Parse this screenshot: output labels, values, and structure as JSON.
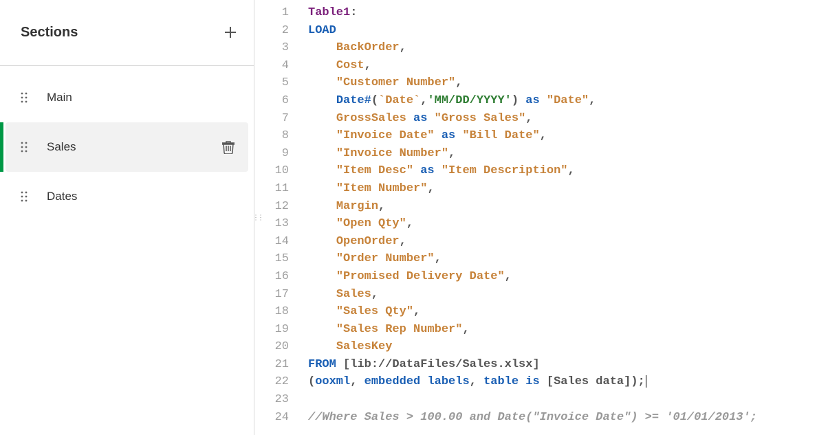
{
  "sidebar": {
    "title": "Sections",
    "items": [
      {
        "label": "Main",
        "active": false
      },
      {
        "label": "Sales",
        "active": true
      },
      {
        "label": "Dates",
        "active": false
      }
    ]
  },
  "editor": {
    "lines": [
      [
        {
          "c": "tk-tbl",
          "t": "Table1"
        },
        {
          "c": "tk-punct",
          "t": ":"
        }
      ],
      [
        {
          "c": "tk-key",
          "t": "LOAD"
        }
      ],
      [
        {
          "c": "tk-plain",
          "t": "    "
        },
        {
          "c": "tk-field",
          "t": "BackOrder"
        },
        {
          "c": "tk-punct",
          "t": ","
        }
      ],
      [
        {
          "c": "tk-plain",
          "t": "    "
        },
        {
          "c": "tk-field",
          "t": "Cost"
        },
        {
          "c": "tk-punct",
          "t": ","
        }
      ],
      [
        {
          "c": "tk-plain",
          "t": "    "
        },
        {
          "c": "tk-str",
          "t": "\"Customer Number\""
        },
        {
          "c": "tk-punct",
          "t": ","
        }
      ],
      [
        {
          "c": "tk-plain",
          "t": "    "
        },
        {
          "c": "tk-fn",
          "t": "Date#"
        },
        {
          "c": "tk-punct",
          "t": "("
        },
        {
          "c": "tk-btick",
          "t": "`Date`"
        },
        {
          "c": "tk-punct",
          "t": ","
        },
        {
          "c": "tk-lit",
          "t": "'MM/DD/YYYY'"
        },
        {
          "c": "tk-punct",
          "t": ")"
        },
        {
          "c": "tk-plain",
          "t": " "
        },
        {
          "c": "tk-as",
          "t": "as"
        },
        {
          "c": "tk-plain",
          "t": " "
        },
        {
          "c": "tk-str",
          "t": "\"Date\""
        },
        {
          "c": "tk-punct",
          "t": ","
        }
      ],
      [
        {
          "c": "tk-plain",
          "t": "    "
        },
        {
          "c": "tk-field",
          "t": "GrossSales"
        },
        {
          "c": "tk-plain",
          "t": " "
        },
        {
          "c": "tk-as",
          "t": "as"
        },
        {
          "c": "tk-plain",
          "t": " "
        },
        {
          "c": "tk-str",
          "t": "\"Gross Sales\""
        },
        {
          "c": "tk-punct",
          "t": ","
        }
      ],
      [
        {
          "c": "tk-plain",
          "t": "    "
        },
        {
          "c": "tk-str",
          "t": "\"Invoice Date\""
        },
        {
          "c": "tk-plain",
          "t": " "
        },
        {
          "c": "tk-as",
          "t": "as"
        },
        {
          "c": "tk-plain",
          "t": " "
        },
        {
          "c": "tk-str",
          "t": "\"Bill Date\""
        },
        {
          "c": "tk-punct",
          "t": ","
        }
      ],
      [
        {
          "c": "tk-plain",
          "t": "    "
        },
        {
          "c": "tk-str",
          "t": "\"Invoice Number\""
        },
        {
          "c": "tk-punct",
          "t": ","
        }
      ],
      [
        {
          "c": "tk-plain",
          "t": "    "
        },
        {
          "c": "tk-str",
          "t": "\"Item Desc\""
        },
        {
          "c": "tk-plain",
          "t": " "
        },
        {
          "c": "tk-as",
          "t": "as"
        },
        {
          "c": "tk-plain",
          "t": " "
        },
        {
          "c": "tk-str",
          "t": "\"Item Description\""
        },
        {
          "c": "tk-punct",
          "t": ","
        }
      ],
      [
        {
          "c": "tk-plain",
          "t": "    "
        },
        {
          "c": "tk-str",
          "t": "\"Item Number\""
        },
        {
          "c": "tk-punct",
          "t": ","
        }
      ],
      [
        {
          "c": "tk-plain",
          "t": "    "
        },
        {
          "c": "tk-field",
          "t": "Margin"
        },
        {
          "c": "tk-punct",
          "t": ","
        }
      ],
      [
        {
          "c": "tk-plain",
          "t": "    "
        },
        {
          "c": "tk-str",
          "t": "\"Open Qty\""
        },
        {
          "c": "tk-punct",
          "t": ","
        }
      ],
      [
        {
          "c": "tk-plain",
          "t": "    "
        },
        {
          "c": "tk-field",
          "t": "OpenOrder"
        },
        {
          "c": "tk-punct",
          "t": ","
        }
      ],
      [
        {
          "c": "tk-plain",
          "t": "    "
        },
        {
          "c": "tk-str",
          "t": "\"Order Number\""
        },
        {
          "c": "tk-punct",
          "t": ","
        }
      ],
      [
        {
          "c": "tk-plain",
          "t": "    "
        },
        {
          "c": "tk-str",
          "t": "\"Promised Delivery Date\""
        },
        {
          "c": "tk-punct",
          "t": ","
        }
      ],
      [
        {
          "c": "tk-plain",
          "t": "    "
        },
        {
          "c": "tk-field",
          "t": "Sales"
        },
        {
          "c": "tk-punct",
          "t": ","
        }
      ],
      [
        {
          "c": "tk-plain",
          "t": "    "
        },
        {
          "c": "tk-str",
          "t": "\"Sales Qty\""
        },
        {
          "c": "tk-punct",
          "t": ","
        }
      ],
      [
        {
          "c": "tk-plain",
          "t": "    "
        },
        {
          "c": "tk-str",
          "t": "\"Sales Rep Number\""
        },
        {
          "c": "tk-punct",
          "t": ","
        }
      ],
      [
        {
          "c": "tk-plain",
          "t": "    "
        },
        {
          "c": "tk-field",
          "t": "SalesKey"
        }
      ],
      [
        {
          "c": "tk-key",
          "t": "FROM"
        },
        {
          "c": "tk-plain",
          "t": " "
        },
        {
          "c": "tk-src",
          "t": "[lib://DataFiles/Sales.xlsx]"
        }
      ],
      [
        {
          "c": "tk-punct",
          "t": "("
        },
        {
          "c": "tk-key",
          "t": "ooxml"
        },
        {
          "c": "tk-punct",
          "t": ", "
        },
        {
          "c": "tk-key",
          "t": "embedded labels"
        },
        {
          "c": "tk-punct",
          "t": ", "
        },
        {
          "c": "tk-key",
          "t": "table is"
        },
        {
          "c": "tk-plain",
          "t": " "
        },
        {
          "c": "tk-src",
          "t": "[Sales data]"
        },
        {
          "c": "tk-punct",
          "t": ");"
        }
      ],
      [],
      [
        {
          "c": "tk-cmt",
          "t": "//Where Sales > 100.00 and Date(\"Invoice Date\") >= '01/01/2013';"
        }
      ]
    ],
    "caret_line": 22
  }
}
